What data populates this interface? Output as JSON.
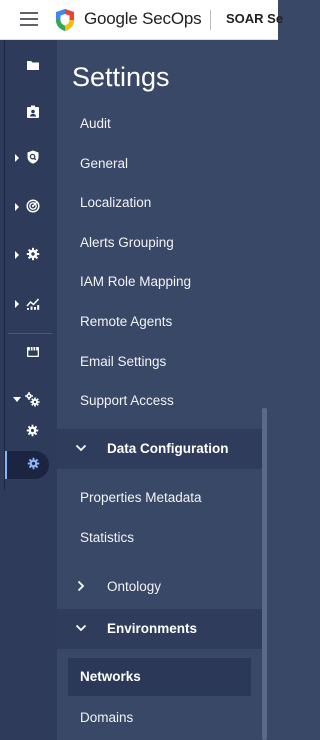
{
  "header": {
    "brand": "Google SecOps",
    "product": "SOAR Se"
  },
  "rail": {
    "items": [
      {
        "icon": "folder-icon"
      },
      {
        "icon": "contact-card-icon"
      },
      {
        "icon": "shield-search-icon"
      },
      {
        "icon": "radar-icon"
      },
      {
        "icon": "gear-icon"
      },
      {
        "icon": "analytics-icon"
      },
      {
        "icon": "storefront-icon"
      },
      {
        "icon": "gears-icon"
      },
      {
        "icon": "gear-small-icon"
      },
      {
        "icon": "gear-small-active-icon"
      }
    ]
  },
  "panel": {
    "title": "Settings",
    "items_top": [
      "Audit",
      "General",
      "Localization",
      "Alerts Grouping",
      "IAM Role Mapping",
      "Remote Agents",
      "Email Settings",
      "Support Access"
    ],
    "data_configuration": {
      "label": "Data Configuration",
      "items": [
        "Properties Metadata",
        "Statistics"
      ]
    },
    "ontology": {
      "label": "Ontology"
    },
    "environments": {
      "label": "Environments",
      "selected": "Networks",
      "items": [
        "Domains"
      ]
    }
  },
  "colors": {
    "rail_bg": "#2e3b5a",
    "panel_bg": "#3a4868",
    "section_bg": "#2f3c5c",
    "accent": "#8ab4f8"
  }
}
